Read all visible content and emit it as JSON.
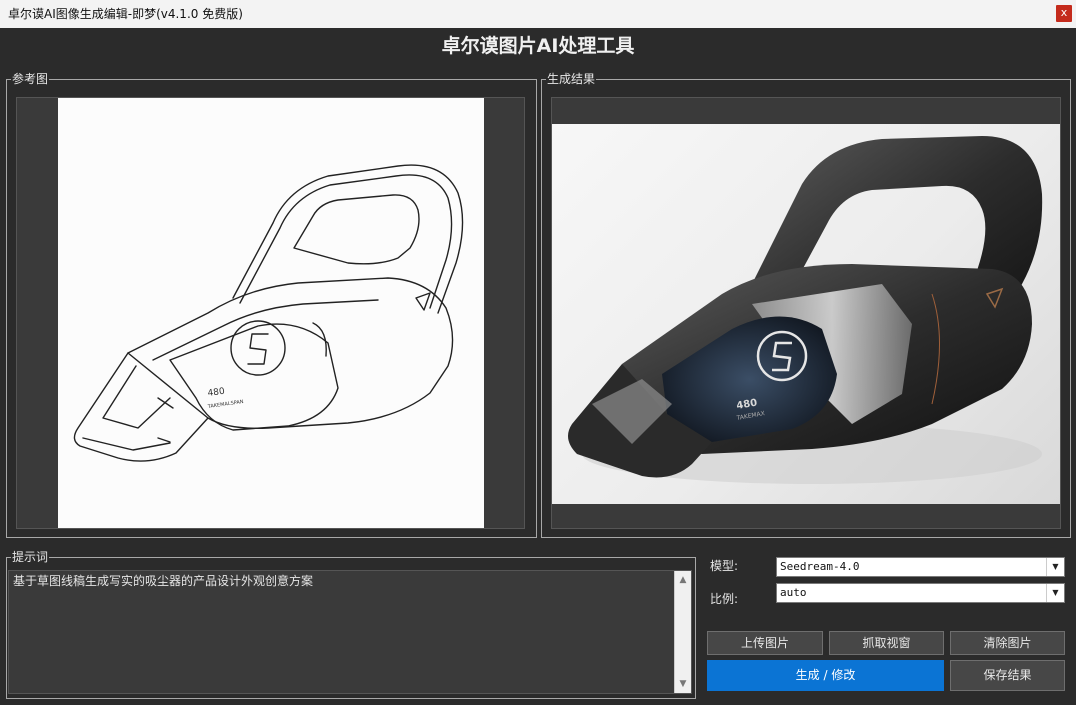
{
  "window": {
    "title": "卓尔谟AI图像生成编辑-即梦(v4.1.0 免费版)",
    "close_label": "x"
  },
  "app": {
    "title": "卓尔谟图片AI处理工具"
  },
  "reference": {
    "legend": "参考图",
    "sketch_text": {
      "logo": "S",
      "model": "480",
      "brand": "TAKEMALSPAN"
    }
  },
  "result": {
    "legend": "生成结果",
    "photo_text": {
      "logo": "S",
      "model": "480",
      "brand": "TAKEMAX"
    }
  },
  "prompt": {
    "legend": "提示词",
    "value": "基于草图线稿生成写实的吸尘器的产品设计外观创意方案"
  },
  "model": {
    "label": "模型:",
    "value": "Seedream-4.0"
  },
  "ratio": {
    "label": "比例:",
    "value": "auto"
  },
  "buttons": {
    "upload": "上传图片",
    "capture": "抓取视窗",
    "clear": "清除图片",
    "generate": "生成 / 修改",
    "save": "保存结果"
  },
  "colors": {
    "accent": "#0b74d4",
    "background": "#2b2b2b",
    "close": "#c42b1c"
  }
}
